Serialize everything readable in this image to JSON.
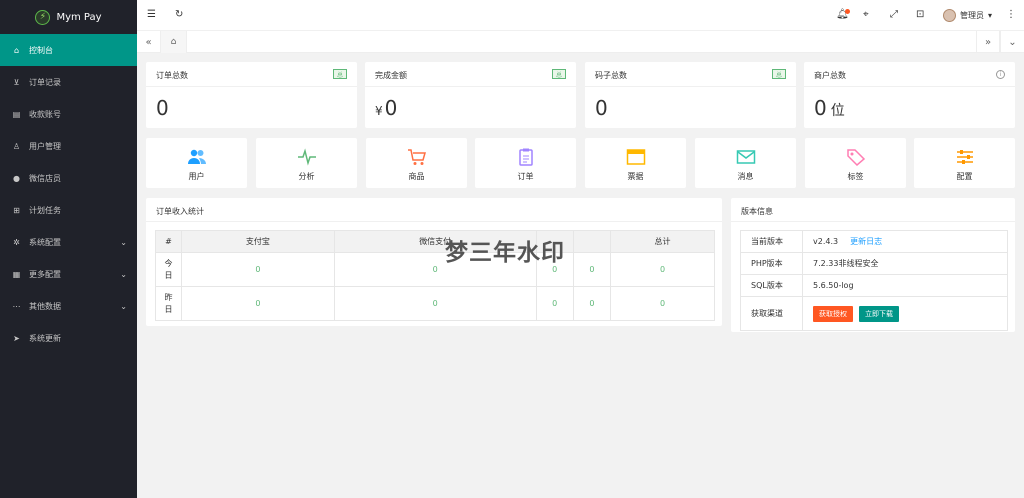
{
  "app": {
    "name": "Mym Pay"
  },
  "sidebar": {
    "items": [
      {
        "label": "控制台",
        "icon": "home-icon",
        "active": true
      },
      {
        "label": "订单记录",
        "icon": "cart-icon"
      },
      {
        "label": "收款账号",
        "icon": "account-icon"
      },
      {
        "label": "用户管理",
        "icon": "user-icon"
      },
      {
        "label": "微信店员",
        "icon": "wechat-icon"
      },
      {
        "label": "计划任务",
        "icon": "task-icon"
      },
      {
        "label": "系统配置",
        "icon": "gear-icon",
        "expandable": true
      },
      {
        "label": "更多配置",
        "icon": "grid-icon",
        "expandable": true
      },
      {
        "label": "其他数据",
        "icon": "dots-icon",
        "expandable": true
      },
      {
        "label": "系统更新",
        "icon": "send-icon"
      }
    ]
  },
  "header": {
    "admin_label": "管理员"
  },
  "stats": [
    {
      "title": "订单总数",
      "tag": "总",
      "value": "0"
    },
    {
      "title": "完成金额",
      "tag": "总",
      "currency": "¥",
      "value": "0"
    },
    {
      "title": "码子总数",
      "tag": "总",
      "value": "0"
    },
    {
      "title": "商户总数",
      "value": "0",
      "unit": "位"
    }
  ],
  "shortcuts": [
    {
      "label": "用户",
      "icon": "users-icon",
      "color": "#1e9fff"
    },
    {
      "label": "分析",
      "icon": "pulse-icon",
      "color": "#5fb878"
    },
    {
      "label": "商品",
      "icon": "cart-icon",
      "color": "#ff7043"
    },
    {
      "label": "订单",
      "icon": "clipboard-icon",
      "color": "#a084ff"
    },
    {
      "label": "票据",
      "icon": "card-icon",
      "color": "#ffb800"
    },
    {
      "label": "消息",
      "icon": "mail-icon",
      "color": "#36c9b3"
    },
    {
      "label": "标签",
      "icon": "tag-icon",
      "color": "#ff7eb3"
    },
    {
      "label": "配置",
      "icon": "sliders-icon",
      "color": "#ff9800"
    }
  ],
  "order_stats": {
    "title": "订单收入统计",
    "columns": [
      "#",
      "支付宝",
      "微信支付",
      "",
      "",
      "总计"
    ],
    "rows": [
      {
        "label": "今日",
        "values": [
          "0",
          "0",
          "0",
          "0",
          "0"
        ]
      },
      {
        "label": "昨日",
        "values": [
          "0",
          "0",
          "0",
          "0",
          "0"
        ]
      }
    ]
  },
  "watermark": "梦三年水印",
  "version_info": {
    "title": "版本信息",
    "current_label": "当前版本",
    "current_value": "v2.4.3",
    "changelog_link": "更新日志",
    "php_label": "PHP版本",
    "php_value": "7.2.33非线程安全",
    "sql_label": "SQL版本",
    "sql_value": "5.6.50-log",
    "channel_label": "获取渠道",
    "btn_license": "获取授权",
    "btn_download": "立即下载"
  }
}
